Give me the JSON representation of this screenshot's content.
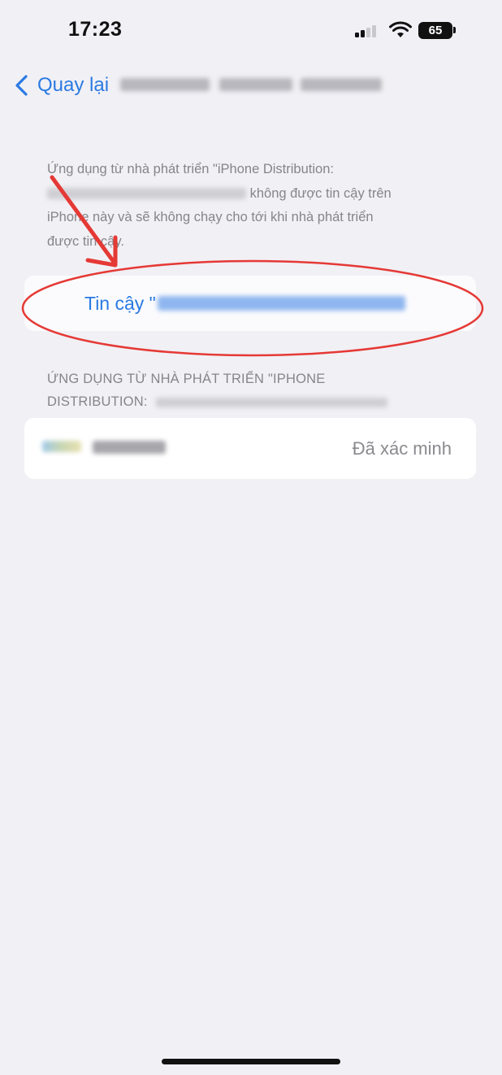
{
  "status_bar": {
    "time": "17:23",
    "battery_percent": "65",
    "icons": [
      "signal-icon",
      "wifi-icon",
      "battery-icon"
    ]
  },
  "nav": {
    "back_label": "Quay lại",
    "title_redacted": true
  },
  "info": {
    "line1": "Ứng dụng từ nhà phát triển \"iPhone Distribution:",
    "line2_suffix": "không được tin cậy trên",
    "line3": "iPhone này và sẽ không chạy cho tới khi nhà phát triển",
    "line4": "được tin cậy."
  },
  "trust": {
    "label": "Tin cậy \""
  },
  "section": {
    "line1": "ỨNG DỤNG TỪ NHÀ PHÁT TRIỂN \"IPHONE",
    "line2": "DISTRIBUTION:"
  },
  "app_row": {
    "status": "Đã xác minh"
  },
  "colors": {
    "background": "#f1f0f5",
    "accent_blue": "#2a7ae2",
    "secondary_text": "#85858a",
    "annotation_red": "#e53935"
  }
}
